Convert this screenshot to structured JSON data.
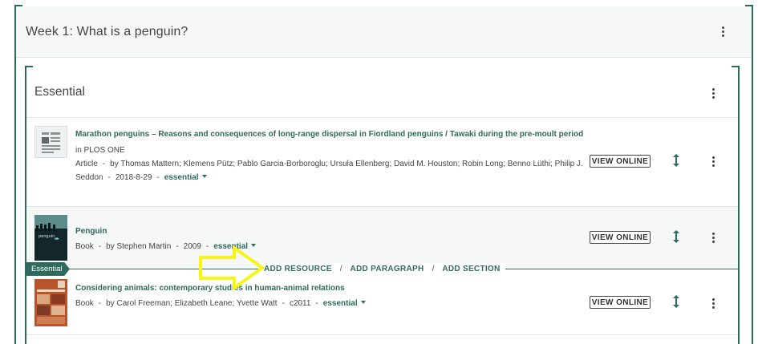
{
  "week": {
    "title": "Week 1: What is a penguin?"
  },
  "section": {
    "title": "Essential"
  },
  "resources": [
    {
      "title": "Marathon penguins – Reasons and consequences of long-range dispersal in Fiordland penguins / Tawaki during the pre-moult period",
      "in_label": "in PLOS ONE",
      "type": "Article",
      "authors": "by Thomas Mattern; Klemens Pütz; Pablo Garcia-Borboroglu; Ursula Ellenberg; David M. Houston; Robin Long; Benno Lüthi; Philip J. Seddon",
      "date": "2018-8-29",
      "importance": "essential",
      "button": "VIEW ONLINE"
    },
    {
      "title": "Penguin",
      "type": "Book",
      "authors": "by Stephen Martin",
      "date": "2009",
      "importance": "essential",
      "button": "VIEW ONLINE"
    },
    {
      "title": "Considering animals: contemporary studies in human-animal relations",
      "type": "Book",
      "authors": "by Carol Freeman; Elizabeth Leane; Yvette Watt",
      "date": "c2011",
      "importance": "essential",
      "button": "VIEW ONLINE"
    }
  ],
  "insert_bar": {
    "tag": "Essential",
    "add_resource": "ADD RESOURCE",
    "slash_1": "/",
    "add_paragraph": "ADD PARAGRAPH",
    "slash_2": "/",
    "add_section": "ADD SECTION"
  },
  "separators": {
    "dash": "-"
  },
  "colors": {
    "accent": "#2e6b5e",
    "highlight_arrow": "#f5f51a",
    "row_hover": "#f6f7f7"
  },
  "icons": {
    "kebab": "vertical-ellipsis-icon",
    "move": "up-down-arrow-icon",
    "pointer": "right-arrow-icon",
    "article": "document-icon"
  }
}
